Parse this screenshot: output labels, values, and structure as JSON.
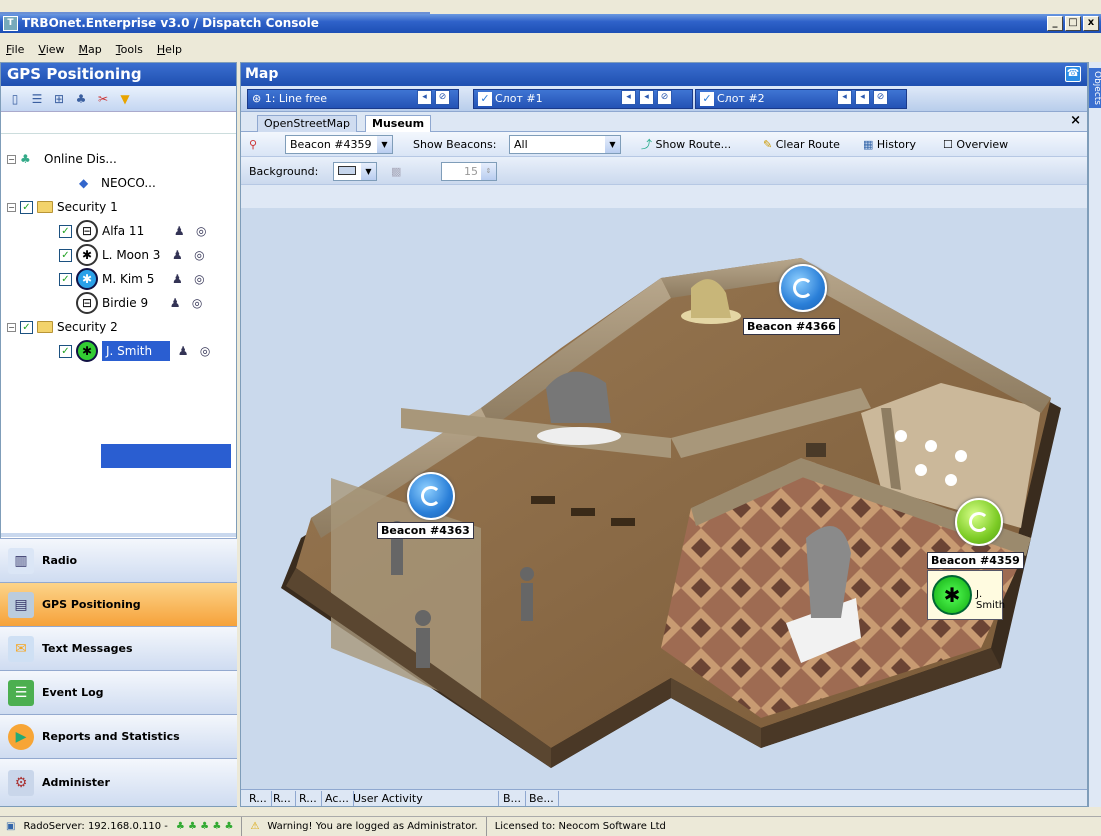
{
  "window": {
    "title": "TRBOnet.Enterprise v3.0 / Dispatch Console",
    "btn_min": "_",
    "btn_max": "□",
    "btn_close": "x"
  },
  "menu": [
    "File",
    "View",
    "Map",
    "Tools",
    "Help"
  ],
  "left_panel": {
    "title": "GPS Positioning",
    "tree": [
      {
        "label": "Online Dis...",
        "type": "server"
      },
      {
        "label": "NEOCO...",
        "type": "node"
      },
      {
        "label": "Security 1",
        "type": "group"
      },
      {
        "label": "Alfa 11",
        "type": "radio"
      },
      {
        "label": "L. Moon 3",
        "type": "radio"
      },
      {
        "label": "M. Kim 5",
        "type": "radio"
      },
      {
        "label": "Birdie 9",
        "type": "radio"
      },
      {
        "label": "Security 2",
        "type": "group"
      },
      {
        "label": "J. Smith",
        "type": "radio",
        "selected": true
      }
    ]
  },
  "nav": [
    "Radio",
    "GPS Positioning",
    "Text Messages",
    "Event Log",
    "Reports and Statistics",
    "Administer"
  ],
  "map": {
    "title": "Map",
    "line1": "1: Line free",
    "slot1": "Слот #1",
    "slot2": "Слот #2",
    "tabs": [
      "OpenStreetMap",
      "Museum"
    ],
    "active_tab": "Museum",
    "beacon_select": "Beacon #4359",
    "show_beacons_label": "Show Beacons:",
    "show_beacons_value": "All",
    "show_route": "Show Route...",
    "clear_route": "Clear Route",
    "history": "History",
    "overview": "Overview",
    "background_label": "Background:",
    "opacity_value": "15",
    "beacons": [
      {
        "label": "Beacon #4366",
        "color": "blue"
      },
      {
        "label": "Beacon #4363",
        "color": "blue"
      },
      {
        "label": "Beacon #4359",
        "color": "green"
      }
    ],
    "person": "J. Smith",
    "bottom_tabs": [
      "R...",
      "R...",
      "R...",
      "Ac...",
      "User Activity",
      "B...",
      "Be..."
    ]
  },
  "right_strip": "Objects",
  "status": {
    "server": "RadoServer: 192.168.0.110 -",
    "warning": "Warning! You are logged as Administrator.",
    "license": "Licensed to: Neocom Software Ltd"
  },
  "colors": {
    "title_blue": "#2f62c9",
    "active_nav": "#f6a23a",
    "beacon_blue": "#2a7fd8",
    "beacon_green": "#7ccb25"
  }
}
